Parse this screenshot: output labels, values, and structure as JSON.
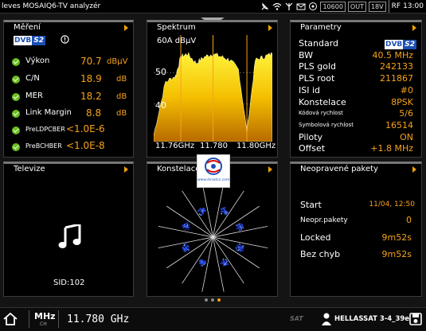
{
  "app": {
    "title": "leves MOSAIQ6-TV analyzér"
  },
  "statusbar": {
    "freq_box": "10600",
    "out_box": "OUT",
    "volt_box": "18V",
    "rf_label": "RF",
    "time": "13:00"
  },
  "measure": {
    "title": "Měření",
    "logo_a": "DVB",
    "logo_b": "S2",
    "rows": [
      {
        "label": "Výkon",
        "value": "70.7",
        "unit": "dBµV"
      },
      {
        "label": "C/N",
        "value": "18.9",
        "unit": "dB"
      },
      {
        "label": "MER",
        "value": "18.2",
        "unit": "dB"
      },
      {
        "label": "Link Margin",
        "value": "8.8",
        "unit": "dB"
      },
      {
        "label": "PreLDPCBER",
        "value": "<1.0E-6",
        "unit": ""
      },
      {
        "label": "PreBCHBER",
        "value": "<1.0E-8",
        "unit": ""
      }
    ]
  },
  "spectrum": {
    "title": "Spektrum",
    "ref_label": "60A dBµV",
    "y_labels": [
      "50",
      "40"
    ],
    "x_labels": [
      "11.76GHz",
      "11.780",
      "11.80GHz"
    ]
  },
  "chart_data": {
    "type": "area",
    "x": [
      11.745,
      11.752,
      11.758,
      11.761,
      11.765,
      11.77,
      11.775,
      11.78,
      11.785,
      11.79,
      11.795,
      11.8,
      11.805,
      11.81,
      11.815
    ],
    "series": [
      {
        "values": [
          30,
          47,
          49,
          55,
          56,
          53,
          55,
          56,
          55,
          54,
          51,
          31,
          54,
          55,
          56
        ]
      }
    ],
    "ylim": [
      28,
      62
    ],
    "xlabel": "",
    "ylabel": ""
  },
  "params": {
    "title": "Parametry",
    "logo_a": "DVB",
    "logo_b": "S2",
    "rows": [
      {
        "label": "Standard",
        "value": ""
      },
      {
        "label": "BW",
        "value": "40.5 MHz"
      },
      {
        "label": "PLS gold",
        "value": "242133"
      },
      {
        "label": "PLS root",
        "value": "211867"
      },
      {
        "label": "ISI id",
        "value": "#0"
      },
      {
        "label": "Konstelace",
        "value": "8PSK"
      },
      {
        "label": "Kódová rychlost",
        "value": "5/6"
      },
      {
        "label": "Symbolová rychlost",
        "value": "16514"
      },
      {
        "label": "Piloty",
        "value": "ON"
      },
      {
        "label": "Offset",
        "value": "+1.8 MHz"
      }
    ]
  },
  "tv": {
    "title": "Televize",
    "sid": "SID:102"
  },
  "const": {
    "title": "Konstelace",
    "watermark": "www.dvsatcs.com"
  },
  "errors": {
    "title": "Neopravené pakety",
    "rows": [
      {
        "label": "Start",
        "value": "11/04, 12:50"
      },
      {
        "label": "Neopr.pakety",
        "value": "0"
      },
      {
        "label": "Locked",
        "value": "9m52s"
      },
      {
        "label": "Bez chyb",
        "value": "9m52s"
      }
    ]
  },
  "bottom": {
    "unit_main": "MHz",
    "unit_sub": "CH",
    "frequency": "11.780 GHz",
    "sat_label": "SAT",
    "satellite": "HELLASSAT 3-4_39e"
  },
  "colors": {
    "accent": "#f7a21a",
    "check": "#6bbf1e",
    "dvb_blue": "#1b4fb5"
  }
}
